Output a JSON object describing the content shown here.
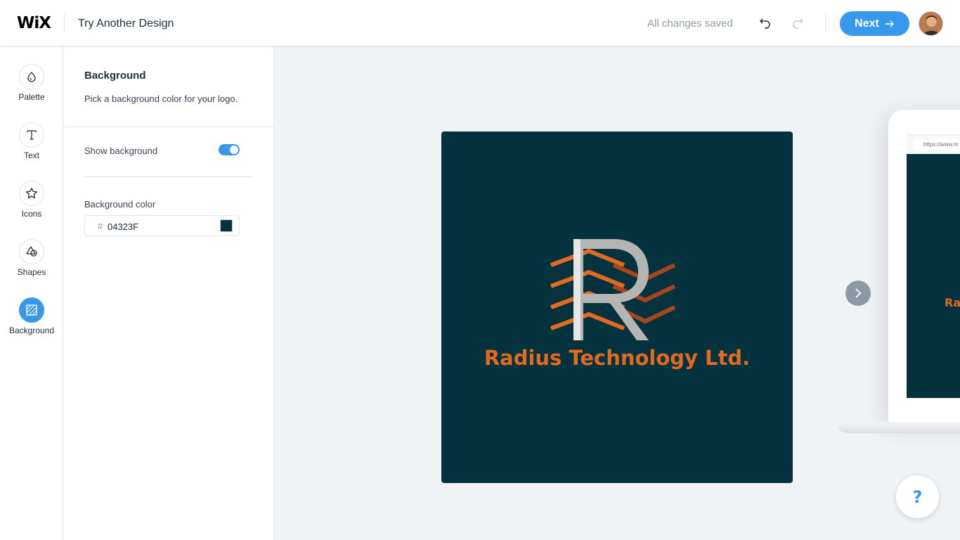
{
  "header": {
    "brand": "WiX",
    "title": "Try Another Design",
    "status": "All changes saved",
    "next_label": "Next",
    "undo_icon": "undo-icon",
    "redo_icon": "redo-icon"
  },
  "rail": {
    "items": [
      {
        "label": "Palette",
        "icon": "palette-drop-icon"
      },
      {
        "label": "Text",
        "icon": "text-t-icon"
      },
      {
        "label": "Icons",
        "icon": "star-icon"
      },
      {
        "label": "Shapes",
        "icon": "shapes-icon"
      },
      {
        "label": "Background",
        "icon": "background-hatch-icon",
        "active": true
      }
    ]
  },
  "panel": {
    "title": "Background",
    "description": "Pick a background color for your logo.",
    "show_background_label": "Show background",
    "show_background": true,
    "background_color_label": "Background color",
    "hash": "#",
    "background_color_value": "04323F"
  },
  "canvas": {
    "brand_text": "Radius Technology Ltd.",
    "laptop_url": "https://www.m",
    "laptop_text": "Ra",
    "help_label": "?"
  },
  "colors": {
    "accent": "#3899ec",
    "logo_background": "#04323F",
    "brand_orange": "#e26a1e",
    "letter_gray": "#b5b5b5"
  }
}
